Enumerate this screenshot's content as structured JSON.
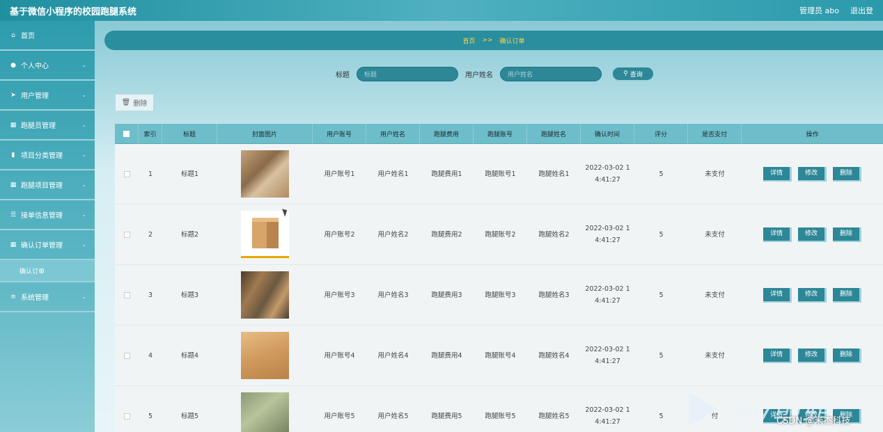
{
  "header": {
    "title": "基于微信小程序的校园跑腿系统",
    "user": "管理员 abo",
    "logout": "退出登"
  },
  "sidebar": {
    "items": [
      {
        "label": "首页",
        "icon": "home-icon",
        "glyph": "⌂"
      },
      {
        "label": "个人中心",
        "icon": "user-icon",
        "glyph": "●"
      },
      {
        "label": "用户管理",
        "icon": "send-icon",
        "glyph": "➤"
      },
      {
        "label": "跑腿员管理",
        "icon": "grid-icon",
        "glyph": "▦"
      },
      {
        "label": "项目分类管理",
        "icon": "bar-chart-icon",
        "glyph": "▮"
      },
      {
        "label": "跑腿项目管理",
        "icon": "grid-icon",
        "glyph": "▦"
      },
      {
        "label": "接单信息管理",
        "icon": "sliders-icon",
        "glyph": "☰"
      },
      {
        "label": "确认订单管理",
        "icon": "grid-icon",
        "glyph": "▦"
      }
    ],
    "sub_item": "确认订单",
    "last_item": {
      "label": "系统管理",
      "icon": "menu-icon",
      "glyph": "≡"
    }
  },
  "breadcrumb": {
    "home": "首页",
    "sep": ">>",
    "current": "确认订单"
  },
  "search": {
    "title_label": "标题",
    "title_placeholder": "标题",
    "name_label": "用户姓名",
    "name_placeholder": "用户姓名",
    "button": "查询"
  },
  "toolbar": {
    "delete": "删除"
  },
  "table": {
    "headers": [
      "索引",
      "标题",
      "封面图片",
      "用户账号",
      "用户姓名",
      "跑腿费用",
      "跑腿账号",
      "跑腿姓名",
      "确认时间",
      "评分",
      "是否支付",
      "操作"
    ],
    "actions": {
      "detail": "详情",
      "edit": "修改",
      "delete": "删除"
    },
    "rows": [
      {
        "index": "1",
        "title": "标题1",
        "account": "用户账号1",
        "name": "用户姓名1",
        "fee": "跑腿费用1",
        "runner_account": "跑腿账号1",
        "runner_name": "跑腿姓名1",
        "time1": "2022-03-02 1",
        "time2": "4:41:27",
        "score": "5",
        "paid": "未支付"
      },
      {
        "index": "2",
        "title": "标题2",
        "account": "用户账号2",
        "name": "用户姓名2",
        "fee": "跑腿费用2",
        "runner_account": "跑腿账号2",
        "runner_name": "跑腿姓名2",
        "time1": "2022-03-02 1",
        "time2": "4:41:27",
        "score": "5",
        "paid": "未支付"
      },
      {
        "index": "3",
        "title": "标题3",
        "account": "用户账号3",
        "name": "用户姓名3",
        "fee": "跑腿费用3",
        "runner_account": "跑腿账号3",
        "runner_name": "跑腿姓名3",
        "time1": "2022-03-02 1",
        "time2": "4:41:27",
        "score": "5",
        "paid": "未支付"
      },
      {
        "index": "4",
        "title": "标题4",
        "account": "用户账号4",
        "name": "用户姓名4",
        "fee": "跑腿费用4",
        "runner_account": "跑腿账号4",
        "runner_name": "跑腿姓名4",
        "time1": "2022-03-02 1",
        "time2": "4:41:27",
        "score": "5",
        "paid": "未支付"
      },
      {
        "index": "5",
        "title": "标题5",
        "account": "用户账号5",
        "name": "用户姓名5",
        "fee": "跑腿费用5",
        "runner_account": "跑腿账号5",
        "runner_name": "跑腿姓名5",
        "time1": "2022-03-02 1",
        "time2": "4:41:27",
        "score": "5",
        "paid": "付"
      }
    ]
  },
  "watermark": {
    "text": "CSDN @米杰科技",
    "logo": "ev剪辑"
  },
  "colors": {
    "primary": "#2d8797",
    "header": "#1f8fa0",
    "crumb_text": "#ffd54a"
  }
}
